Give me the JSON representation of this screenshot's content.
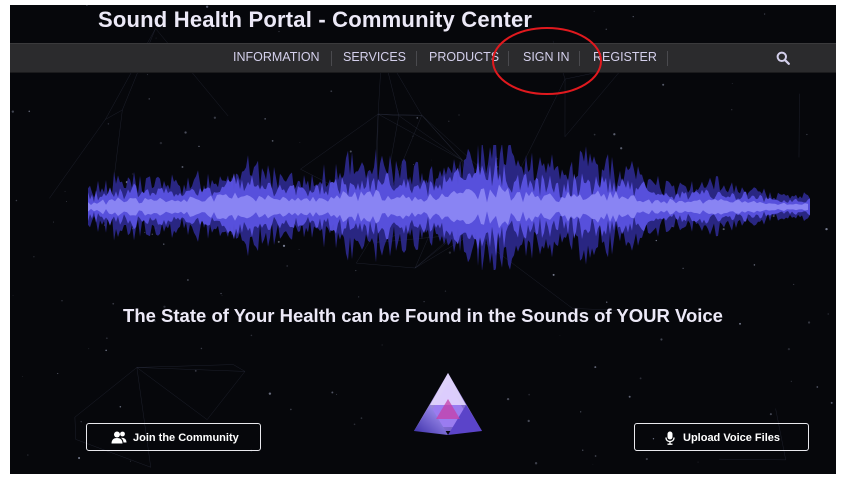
{
  "header": {
    "site_title": "Sound Health Portal - Community Center"
  },
  "nav": {
    "items": [
      {
        "label": "INFORMATION"
      },
      {
        "label": "SERVICES"
      },
      {
        "label": "PRODUCTS"
      },
      {
        "label": "SIGN IN"
      },
      {
        "label": "REGISTER"
      }
    ],
    "search_icon": "search-icon"
  },
  "annotation": {
    "type": "red circle highlighting SIGN IN",
    "color": "#e0191e"
  },
  "hero": {
    "tagline": "The State of Your Health can be Found in the Sounds of YOUR Voice",
    "waveform_colors": [
      "#2e2a8f",
      "#5a52e0",
      "#8f8af5"
    ],
    "logo_icon": "triangle-logo-icon"
  },
  "buttons": {
    "join": {
      "label": "Join the Community",
      "icon": "users-icon"
    },
    "upload": {
      "label": "Upload Voice Files",
      "icon": "microphone-icon"
    }
  },
  "colors": {
    "background": "#06070b",
    "navbar": "#2b2b2d",
    "nav_text": "#d4d0ec"
  }
}
